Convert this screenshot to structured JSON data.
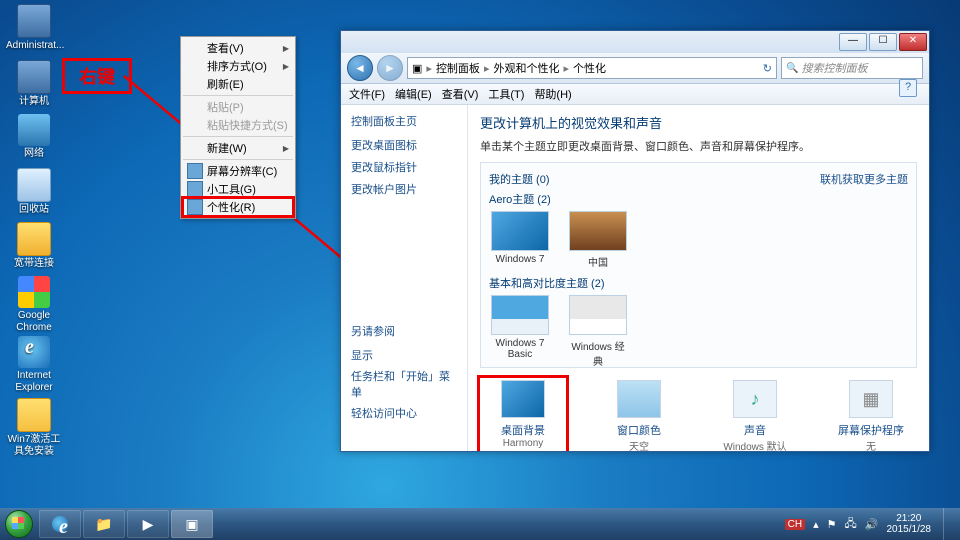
{
  "desktop_icons": {
    "admin": "Administrat...",
    "pc": "计算机",
    "net": "网络",
    "bin": "回收站",
    "bb": "宽带连接",
    "chrome": "Google Chrome",
    "ie": "Internet Explorer",
    "fld": "Win7激活工具免安装"
  },
  "annotation": {
    "right_click": "右键"
  },
  "ctx": {
    "view": "查看(V)",
    "sort": "排序方式(O)",
    "refresh": "刷新(E)",
    "paste": "粘贴(P)",
    "paste_shortcut": "粘贴快捷方式(S)",
    "new": "新建(W)",
    "resolution": "屏幕分辨率(C)",
    "gadgets": "小工具(G)",
    "personalize": "个性化(R)"
  },
  "win": {
    "breadcrumb": {
      "root": "控制面板",
      "p1": "外观和个性化",
      "p2": "个性化"
    },
    "search_ph": "搜索控制面板",
    "menu": {
      "file": "文件(F)",
      "edit": "编辑(E)",
      "view": "查看(V)",
      "tools": "工具(T)",
      "help": "帮助(H)"
    },
    "sidebar": {
      "home": "控制面板主页",
      "l1": "更改桌面图标",
      "l2": "更改鼠标指针",
      "l3": "更改帐户图片",
      "see_also": "另请参阅",
      "s1": "显示",
      "s2": "任务栏和「开始」菜单",
      "s3": "轻松访问中心"
    },
    "content": {
      "title": "更改计算机上的视觉效果和声音",
      "sub": "单击某个主题立即更改桌面背景、窗口颜色、声音和屏幕保护程序。",
      "my_themes": "我的主题 (0)",
      "more": "联机获取更多主题",
      "aero": "Aero主题 (2)",
      "t_win7": "Windows 7",
      "t_cn": "中国",
      "basic_hc": "基本和高对比度主题 (2)",
      "t_basic": "Windows 7 Basic",
      "t_classic": "Windows 经典"
    },
    "bottom": {
      "bg_t": "桌面背景",
      "bg_s": "Harmony",
      "col_t": "窗口颜色",
      "col_s": "天空",
      "snd_t": "声音",
      "snd_s": "Windows 默认",
      "scr_t": "屏幕保护程序",
      "scr_s": "无"
    }
  },
  "tray": {
    "lang": "CH",
    "time": "21:20",
    "date": "2015/1/28"
  }
}
